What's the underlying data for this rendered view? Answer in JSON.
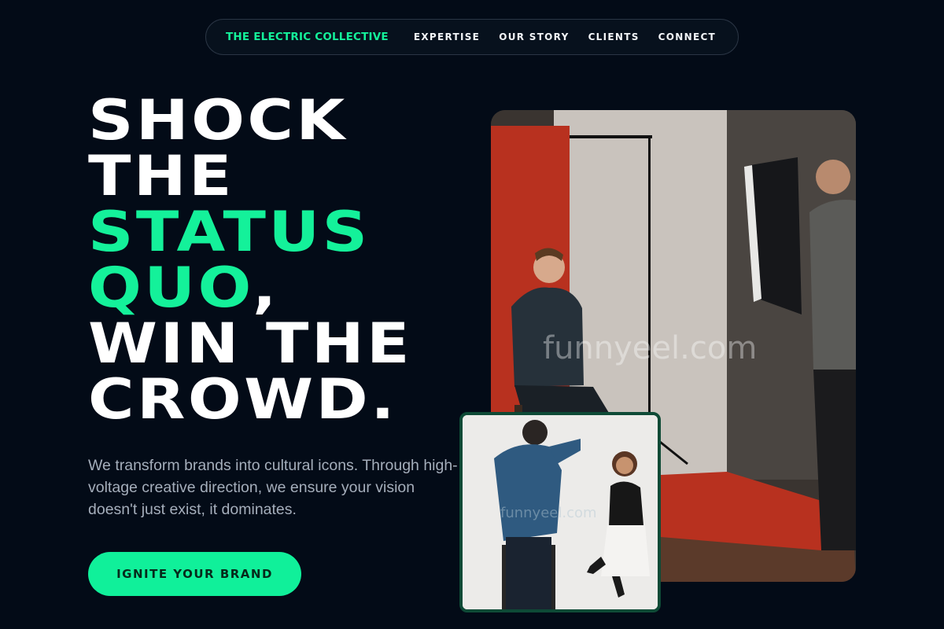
{
  "nav": {
    "brand": "THE ELECTRIC COLLECTIVE",
    "links": [
      "EXPERTISE",
      "OUR STORY",
      "CLIENTS",
      "CONNECT"
    ]
  },
  "hero": {
    "headline": {
      "line1": "SHOCK",
      "line2": "THE",
      "line3": "STATUS",
      "line4_accent": "QUO",
      "line4_rest": ",",
      "line5": "WIN THE",
      "line6": "CROWD."
    },
    "lead": "We transform brands into cultural icons. Through high-voltage creative direction, we ensure your vision doesn't just exist, it dominates.",
    "cta": "IGNITE YOUR BRAND"
  },
  "images": {
    "main_watermark": "funnyeel.com",
    "inset_watermark": "funnyeel.com"
  },
  "colors": {
    "background": "#030b17",
    "accent": "#14f19a",
    "text": "#ffffff",
    "muted": "#a5aebb"
  }
}
